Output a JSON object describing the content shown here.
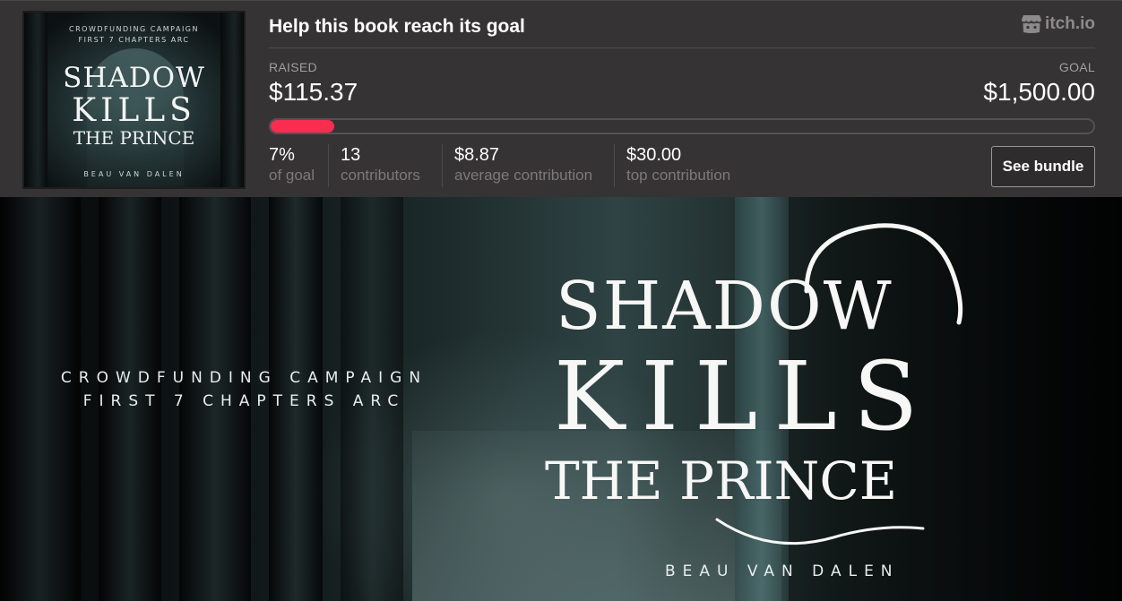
{
  "widget": {
    "title": "Help this book reach its goal",
    "brand": "itch.io",
    "raised_label": "RAISED",
    "raised_value": "$115.37",
    "goal_label": "GOAL",
    "goal_value": "$1,500.00",
    "progress_fraction": 0.077,
    "progress_color": "#fa2c4f",
    "stats": [
      {
        "value": "7%",
        "label": "of goal"
      },
      {
        "value": "13",
        "label": "contributors"
      },
      {
        "value": "$8.87",
        "label": "average contribution"
      },
      {
        "value": "$30.00",
        "label": "top contribution"
      }
    ],
    "button_label": "See bundle"
  },
  "thumbnail": {
    "line1": "CROWDFUNDING CAMPAIGN",
    "line2": "FIRST 7 CHAPTERS ARC",
    "title1": "SHADOW",
    "title2": "KILLS",
    "title3": "THE PRINCE",
    "author": "BEAU VAN DALEN"
  },
  "banner": {
    "line1": "CROWDFUNDING CAMPAIGN",
    "line2": "FIRST 7 CHAPTERS ARC",
    "title1": "SHADOW",
    "title2": "KILLS",
    "title3": "THE PRINCE",
    "author": "BEAU VAN DALEN"
  }
}
